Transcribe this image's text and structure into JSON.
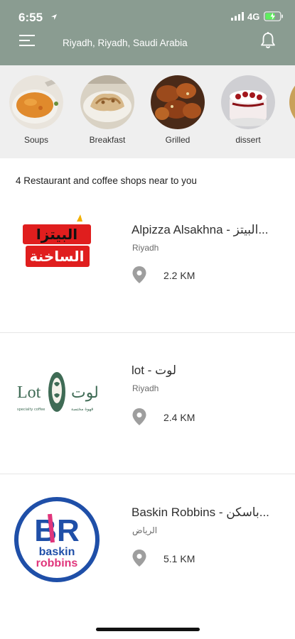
{
  "status_bar": {
    "time": "6:55",
    "network": "4G"
  },
  "header": {
    "location": "Riyadh, Riyadh, Saudi Arabia"
  },
  "categories": [
    {
      "label": "Soups"
    },
    {
      "label": "Breakfast"
    },
    {
      "label": "Grilled"
    },
    {
      "label": "dissert"
    }
  ],
  "section_title": "4 Restaurant and coffee shops near to you",
  "restaurants": [
    {
      "name": "Alpizza Alsakhna - البيتز...",
      "city": "Riyadh",
      "distance": "2.2 KM",
      "logo_text_top": "البيتزا",
      "logo_text_bottom": "الساخنة"
    },
    {
      "name": "lot - لوت",
      "city": "Riyadh",
      "distance": "2.4 KM",
      "logo_text_latin": "Lot",
      "logo_text_arabic": "لوت",
      "logo_sub_latin": "specialty coffee",
      "logo_sub_arabic": "قهوة مختصة"
    },
    {
      "name": "Baskin Robbins - باسكن...",
      "city": "الرياض",
      "distance": "5.1 KM",
      "logo_text_initials": "BR",
      "logo_text_line1": "baskin",
      "logo_text_line2": "robbins"
    }
  ],
  "colors": {
    "header": "#8a9c91",
    "category_bg": "#efefef",
    "pin": "#9e9e9e"
  }
}
